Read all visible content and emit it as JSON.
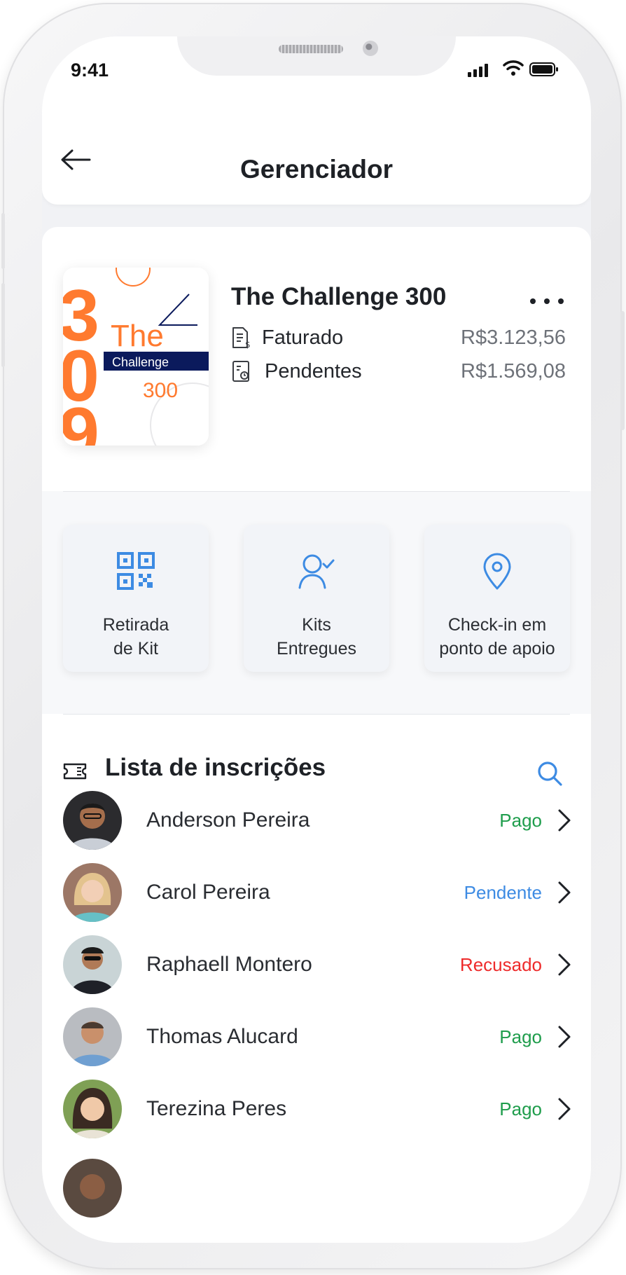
{
  "status_bar": {
    "time": "9:41"
  },
  "header": {
    "title": "Gerenciador"
  },
  "event": {
    "title": "The Challenge 300",
    "poster": {
      "line1": "The",
      "line2": "Challenge",
      "line3": "300"
    },
    "financials": [
      {
        "label": "Faturado",
        "value": "R$3.123,56",
        "icon": "invoice-icon"
      },
      {
        "label": "Pendentes",
        "value": "R$1.569,08",
        "icon": "pending-doc-icon"
      }
    ]
  },
  "actions": [
    {
      "label_line1": "Retirada",
      "label_line2": "de Kit",
      "icon": "qr-code-icon"
    },
    {
      "label_line1": "Kits",
      "label_line2": "Entregues",
      "icon": "user-check-icon"
    },
    {
      "label_line1": "Check-in em",
      "label_line2": "ponto de apoio",
      "icon": "location-pin-icon"
    }
  ],
  "list": {
    "title": "Lista de inscrições",
    "items": [
      {
        "name": "Anderson Pereira",
        "status": "Pago"
      },
      {
        "name": "Carol Pereira",
        "status": "Pendente"
      },
      {
        "name": "Raphaell Montero",
        "status": "Recusado"
      },
      {
        "name": "Thomas Alucard",
        "status": "Pago"
      },
      {
        "name": "Terezina Peres",
        "status": "Pago"
      }
    ]
  },
  "colors": {
    "brand_orange": "#ff7a2f",
    "navy": "#0b1a5c",
    "accent_blue": "#3d8be3",
    "status_paid": "#1f9d4c",
    "status_pending": "#3d8be3",
    "status_refused": "#ee2b2b"
  }
}
